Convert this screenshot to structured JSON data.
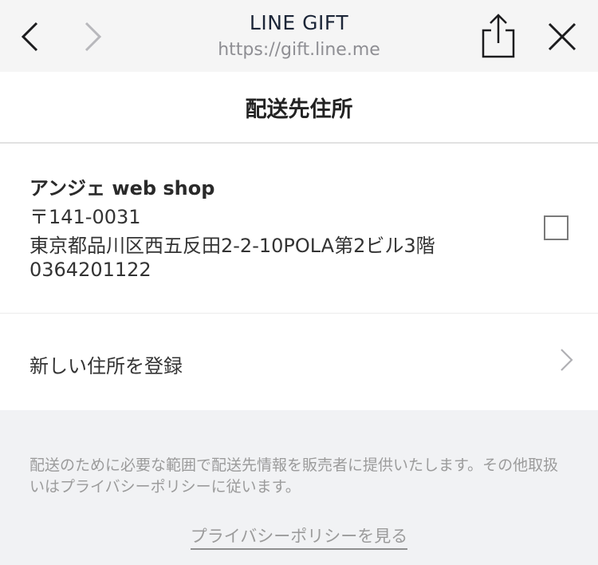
{
  "browser": {
    "title": "LINE GIFT",
    "url": "https://gift.line.me",
    "icons": {
      "back": "chevron-left-icon",
      "forward": "chevron-right-icon",
      "share": "share-icon",
      "close": "close-icon"
    }
  },
  "page": {
    "title": "配送先住所"
  },
  "address": {
    "name": "アンジェ web shop",
    "postal": "〒141-0031",
    "street": "東京都品川区西五反田2-2-10POLA第2ビル3階",
    "phone": "0364201122",
    "selected": false
  },
  "new_address": {
    "label": "新しい住所を登録"
  },
  "footer": {
    "notice": "配送のために必要な範囲で配送先情報を販売者に提供いたします。その他取扱いはプライバシーポリシーに従います。",
    "privacy_link": "プライバシーポリシーを見る"
  },
  "colors": {
    "header_bg": "#f5f5f5",
    "footer_bg": "#f1f2f4",
    "text": "#333333",
    "muted": "#9b9b9b"
  }
}
